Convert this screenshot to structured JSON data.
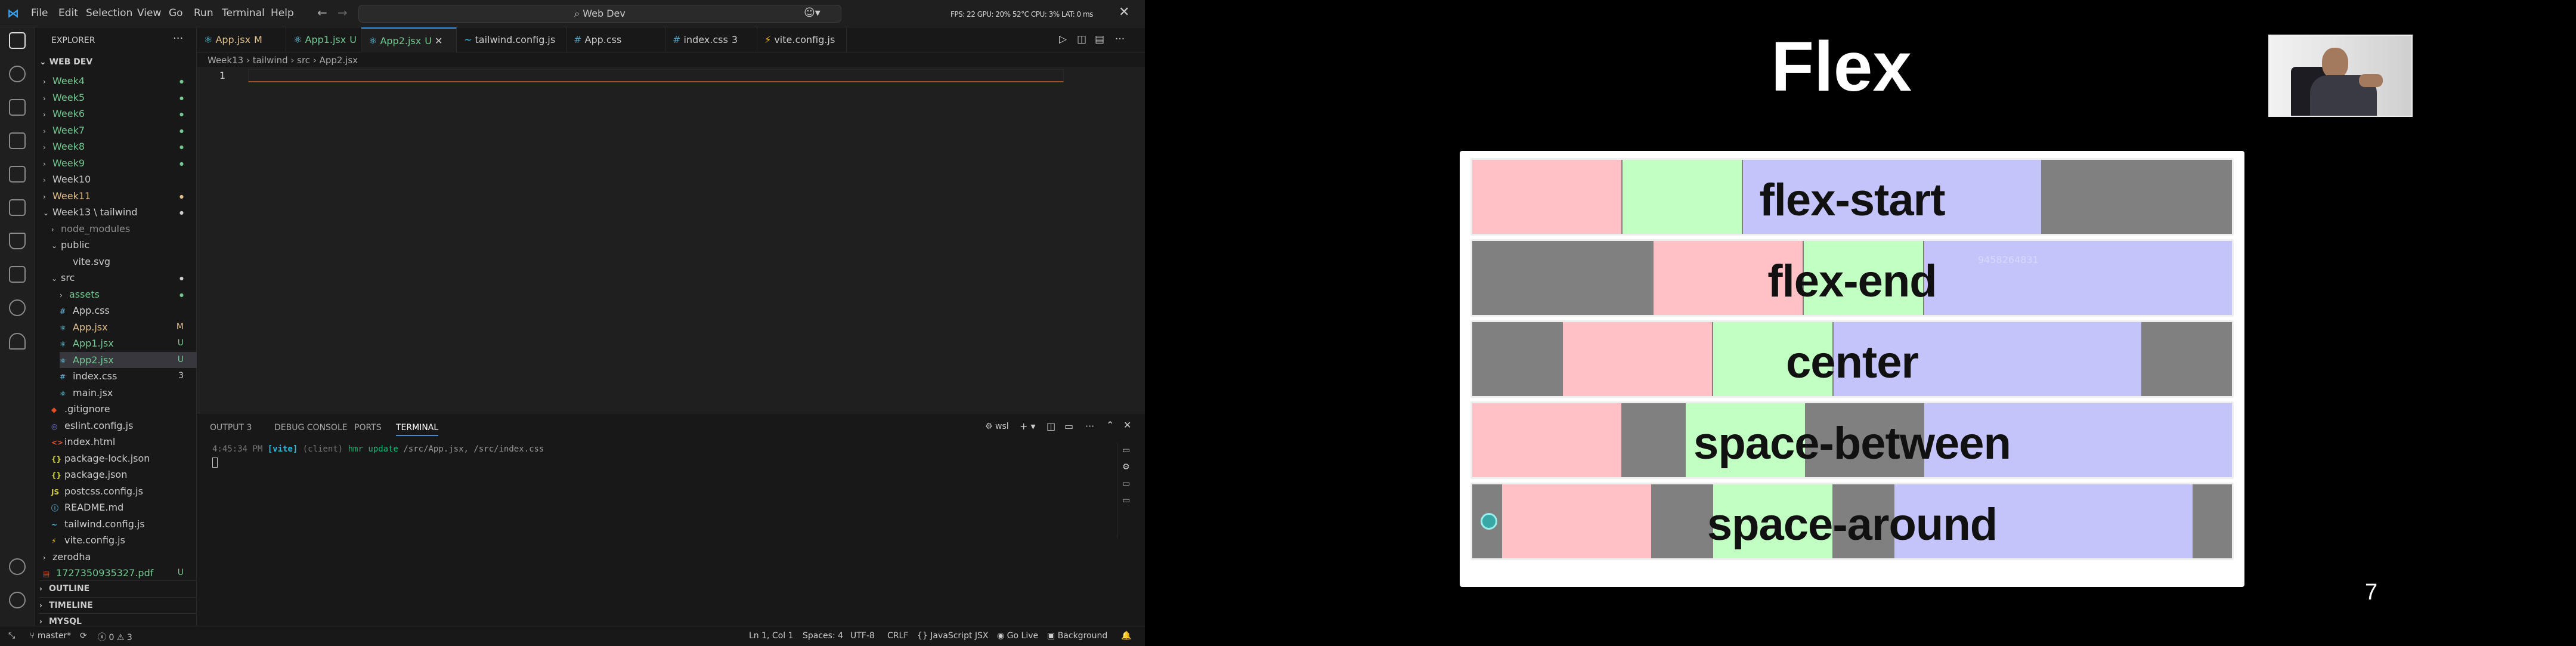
{
  "window": {
    "title": "Web Dev",
    "menus": [
      "File",
      "Edit",
      "Selection",
      "View",
      "Go",
      "Run",
      "Terminal",
      "Help"
    ],
    "perf": "FPS: 22 GPU: 20% 52°C CPU: 3% LAT: 0 ms"
  },
  "explorer": {
    "header": "EXPLORER",
    "root": "WEB DEV",
    "items": [
      {
        "label": "Week4",
        "badge": "●",
        "color": "#73c991",
        "type": "folder"
      },
      {
        "label": "Week5",
        "badge": "●",
        "color": "#73c991",
        "type": "folder"
      },
      {
        "label": "Week6",
        "badge": "●",
        "color": "#73c991",
        "type": "folder"
      },
      {
        "label": "Week7",
        "badge": "●",
        "color": "#73c991",
        "type": "folder"
      },
      {
        "label": "Week8",
        "badge": "●",
        "color": "#73c991",
        "type": "folder"
      },
      {
        "label": "Week9",
        "badge": "●",
        "color": "#73c991",
        "type": "folder"
      },
      {
        "label": "Week10",
        "badge": "",
        "color": "#cccccc",
        "type": "folder"
      },
      {
        "label": "Week11",
        "badge": "●",
        "color": "#e2c08d",
        "type": "folder"
      },
      {
        "label": "Week13 \\ tailwind",
        "badge": "●",
        "color": "#cccccc",
        "type": "folder-open"
      },
      {
        "label": "node_modules",
        "badge": "",
        "color": "#8c8c8c",
        "type": "folder"
      },
      {
        "label": "public",
        "badge": "",
        "color": "#cccccc",
        "type": "folder-open"
      },
      {
        "label": "vite.svg",
        "badge": "",
        "color": "#cccccc",
        "type": "file"
      },
      {
        "label": "src",
        "badge": "●",
        "color": "#cccccc",
        "type": "folder-open"
      },
      {
        "label": "assets",
        "badge": "●",
        "color": "#73c991",
        "type": "folder"
      },
      {
        "label": "App.css",
        "badge": "",
        "color": "#cccccc",
        "type": "css"
      },
      {
        "label": "App.jsx",
        "badge": "M",
        "color": "#e2c08d",
        "type": "jsx"
      },
      {
        "label": "App1.jsx",
        "badge": "U",
        "color": "#73c991",
        "type": "jsx"
      },
      {
        "label": "App2.jsx",
        "badge": "U",
        "color": "#73c991",
        "type": "jsx"
      },
      {
        "label": "index.css",
        "badge": "3",
        "color": "#cccccc",
        "type": "css"
      },
      {
        "label": "main.jsx",
        "badge": "",
        "color": "#cccccc",
        "type": "jsx"
      },
      {
        "label": ".gitignore",
        "badge": "",
        "color": "#cccccc",
        "type": "git"
      },
      {
        "label": "eslint.config.js",
        "badge": "",
        "color": "#cccccc",
        "type": "eslint"
      },
      {
        "label": "index.html",
        "badge": "",
        "color": "#cccccc",
        "type": "html"
      },
      {
        "label": "package-lock.json",
        "badge": "",
        "color": "#cccccc",
        "type": "json"
      },
      {
        "label": "package.json",
        "badge": "",
        "color": "#cccccc",
        "type": "json"
      },
      {
        "label": "postcss.config.js",
        "badge": "",
        "color": "#cccccc",
        "type": "js"
      },
      {
        "label": "README.md",
        "badge": "",
        "color": "#cccccc",
        "type": "md"
      },
      {
        "label": "tailwind.config.js",
        "badge": "",
        "color": "#cccccc",
        "type": "tw"
      },
      {
        "label": "vite.config.js",
        "badge": "",
        "color": "#cccccc",
        "type": "vite"
      },
      {
        "label": "zerodha",
        "badge": "",
        "color": "#cccccc",
        "type": "folder"
      },
      {
        "label": "1727350935327.pdf",
        "badge": "U",
        "color": "#73c991",
        "type": "pdf"
      }
    ],
    "sections": [
      "OUTLINE",
      "TIMELINE",
      "MYSQL"
    ]
  },
  "tabs": [
    {
      "label": "App.jsx",
      "mark": "M",
      "color": "#e2c08d",
      "icon": "⚛"
    },
    {
      "label": "App1.jsx",
      "mark": "U",
      "color": "#73c991",
      "icon": "⚛"
    },
    {
      "label": "App2.jsx",
      "mark": "U",
      "color": "#73c991",
      "icon": "⚛",
      "active": true
    },
    {
      "label": "tailwind.config.js",
      "mark": "",
      "color": "#cccccc",
      "icon": "~"
    },
    {
      "label": "App.css",
      "mark": "",
      "color": "#cccccc",
      "icon": "#"
    },
    {
      "label": "index.css",
      "mark": "3",
      "color": "#cccccc",
      "icon": "#"
    },
    {
      "label": "vite.config.js",
      "mark": "",
      "color": "#cccccc",
      "icon": "⚡"
    }
  ],
  "breadcrumb": [
    "Week13",
    "tailwind",
    "src",
    "App2.jsx"
  ],
  "editor": {
    "line_number": "1"
  },
  "panel": {
    "tabs": [
      "OUTPUT",
      "DEBUG CONSOLE",
      "PORTS",
      "TERMINAL"
    ],
    "output_count": "3",
    "shell": "wsl",
    "terminal_lines": [
      {
        "time": "4:45:34 PM",
        "tag": "[vite]",
        "client": "(client)",
        "hmr": "hmr update",
        "files": "/src/App.jsx, /src/index.css"
      }
    ]
  },
  "status": {
    "branch": "master*",
    "problems": "0",
    "warnings": "3",
    "position": "Ln 1, Col 1",
    "spaces": "Spaces: 4",
    "encoding": "UTF-8",
    "eol": "CRLF",
    "language": "JavaScript JSX",
    "golive": "Go Live",
    "background": "Background"
  },
  "slide": {
    "title": "Flex",
    "page_number": "7",
    "rows": [
      "flex-start",
      "flex-end",
      "center",
      "space-between",
      "space-around"
    ],
    "watermark": "9458264831"
  }
}
